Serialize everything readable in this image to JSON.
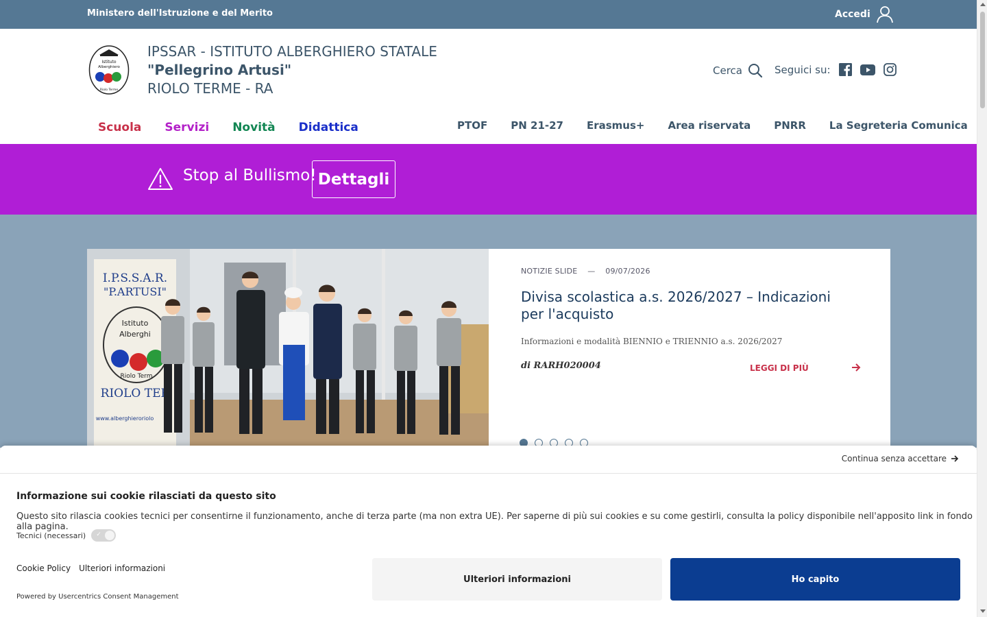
{
  "topbar": {
    "ministry": "Ministero dell'Istruzione e del Merito",
    "login": "Accedi",
    "login_icon": "user-icon"
  },
  "header": {
    "school_line1": "IPSSAR - ISTITUTO ALBERGHIERO STATALE",
    "school_line2": "\"Pellegrino Artusi\"",
    "school_line3": "RIOLO TERME - RA",
    "logo_text": [
      "Istituto",
      "Alberghiero",
      "Riolo Terme"
    ],
    "search_label": "Cerca",
    "social_label": "Seguici su:",
    "social_icons": [
      "facebook-icon",
      "youtube-icon",
      "instagram-icon"
    ]
  },
  "main_nav": [
    {
      "label": "Scuola",
      "color": "#c8314a"
    },
    {
      "label": "Servizi",
      "color": "#b321c8"
    },
    {
      "label": "Novità",
      "color": "#128653"
    },
    {
      "label": "Didattica",
      "color": "#1a2fc9"
    }
  ],
  "secondary_nav": [
    "PTOF",
    "PN 21-27",
    "Erasmus+",
    "Area riservata",
    "PNRR",
    "La Segreteria Comunica"
  ],
  "alert": {
    "message": "Stop al Bullismo!",
    "button": "Dettagli",
    "background": "#b01ed6"
  },
  "slide": {
    "category": "NOTIZIE SLIDE",
    "separator": "—",
    "date": "09/07/2026",
    "title": "Divisa scolastica a.s. 2026/2027 – Indicazioni per l'acquisto",
    "description": "Informazioni e modalità BIENNIO e TRIENNIO a.s. 2026/2027",
    "author": "di RARH020004",
    "read_more": "LEGGI DI PIÙ",
    "banner_text": [
      "I.P.S.S.A.R.",
      "\"P.ARTUSI\"",
      "Istituto",
      "Alberghi",
      "Riolo Term",
      "RIOLO TER",
      "www.alberghieroriolo"
    ],
    "dots_total": 5,
    "dots_active": 1
  },
  "cookie": {
    "continue": "Continua senza accettare",
    "heading": "Informazione sui cookie rilasciati da questo sito",
    "text": "Questo sito rilascia cookies tecnici per consentirne il funzionamento, anche di terza parte (ma non extra UE). Per saperne di più sui cookies e su come gestirli, consulta la policy disponibile nell'apposito link in fondo alla pagina.",
    "technical": "Tecnici (necessari)",
    "link_policy": "Cookie Policy",
    "link_info": "Ulteriori informazioni",
    "powered": "Powered by Usercentrics Consent Management",
    "btn_more": "Ulteriori informazioni",
    "btn_accept": "Ho capito",
    "accent": "#0b3d91"
  }
}
